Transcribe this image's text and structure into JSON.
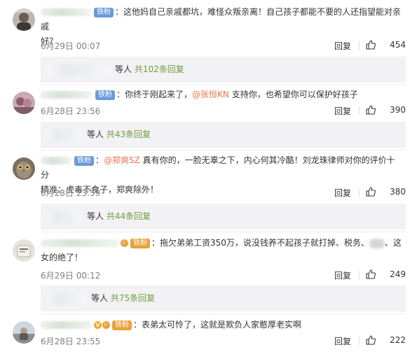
{
  "comments": [
    {
      "fan_badge": "铁粉",
      "content": "：这他妈自己亲戚都坑，难怪众叛亲离！自己孩子都能不要的人还指望能对亲戚",
      "content_line2": "好？",
      "time": "6月29日 00:07",
      "reply_label": "回复",
      "likes": "454",
      "replies_prefix": "等人",
      "replies_link": "共102条回复"
    },
    {
      "fan_badge": "铁粉",
      "content_pre": "：你终于刚起来了，",
      "mention": "@张恒KN",
      "content_post": " 支持你，也希望你可以保护好孩子",
      "time": "6月28日 23:56",
      "reply_label": "回复",
      "likes": "390",
      "replies_prefix": "等人",
      "replies_link": "共43条回复"
    },
    {
      "fan_badge": "铁粉",
      "content_pre": "：",
      "mention": "@郑爽SZ",
      "content_post": " 真有你的，一脸无辜之下，内心何其冷酷！刘龙珠律师对你的评价十分",
      "content_line2": "精准：虎毒不食子，郑爽除外！",
      "time": "6月28日 23:59",
      "reply_label": "回复",
      "likes": "380",
      "replies_prefix": "等人",
      "replies_link": "共44条回复"
    },
    {
      "fan_badge": "铁粉",
      "content": "：拖欠弟弟工资350万，说没钱养不起孩子就打掉、税务、",
      "content_after": "、这",
      "content_line2": "女的绝了！",
      "time": "6月29日 00:12",
      "reply_label": "回复",
      "likes": "249",
      "replies_prefix": "等人",
      "replies_link": "共75条回复"
    },
    {
      "fan_badge": "铁粉",
      "vmark": "V",
      "content": "：表弟太可怜了，这就是欺负人家憨厚老实啊",
      "time": "6月28日 23:55",
      "reply_label": "回复",
      "likes": "222"
    }
  ],
  "colors": {
    "mention": "#eb7350",
    "reply_link": "#6f9c3d",
    "fan_badge": "#6a9bd8",
    "fan_badge_gold": "#e8a13b"
  }
}
